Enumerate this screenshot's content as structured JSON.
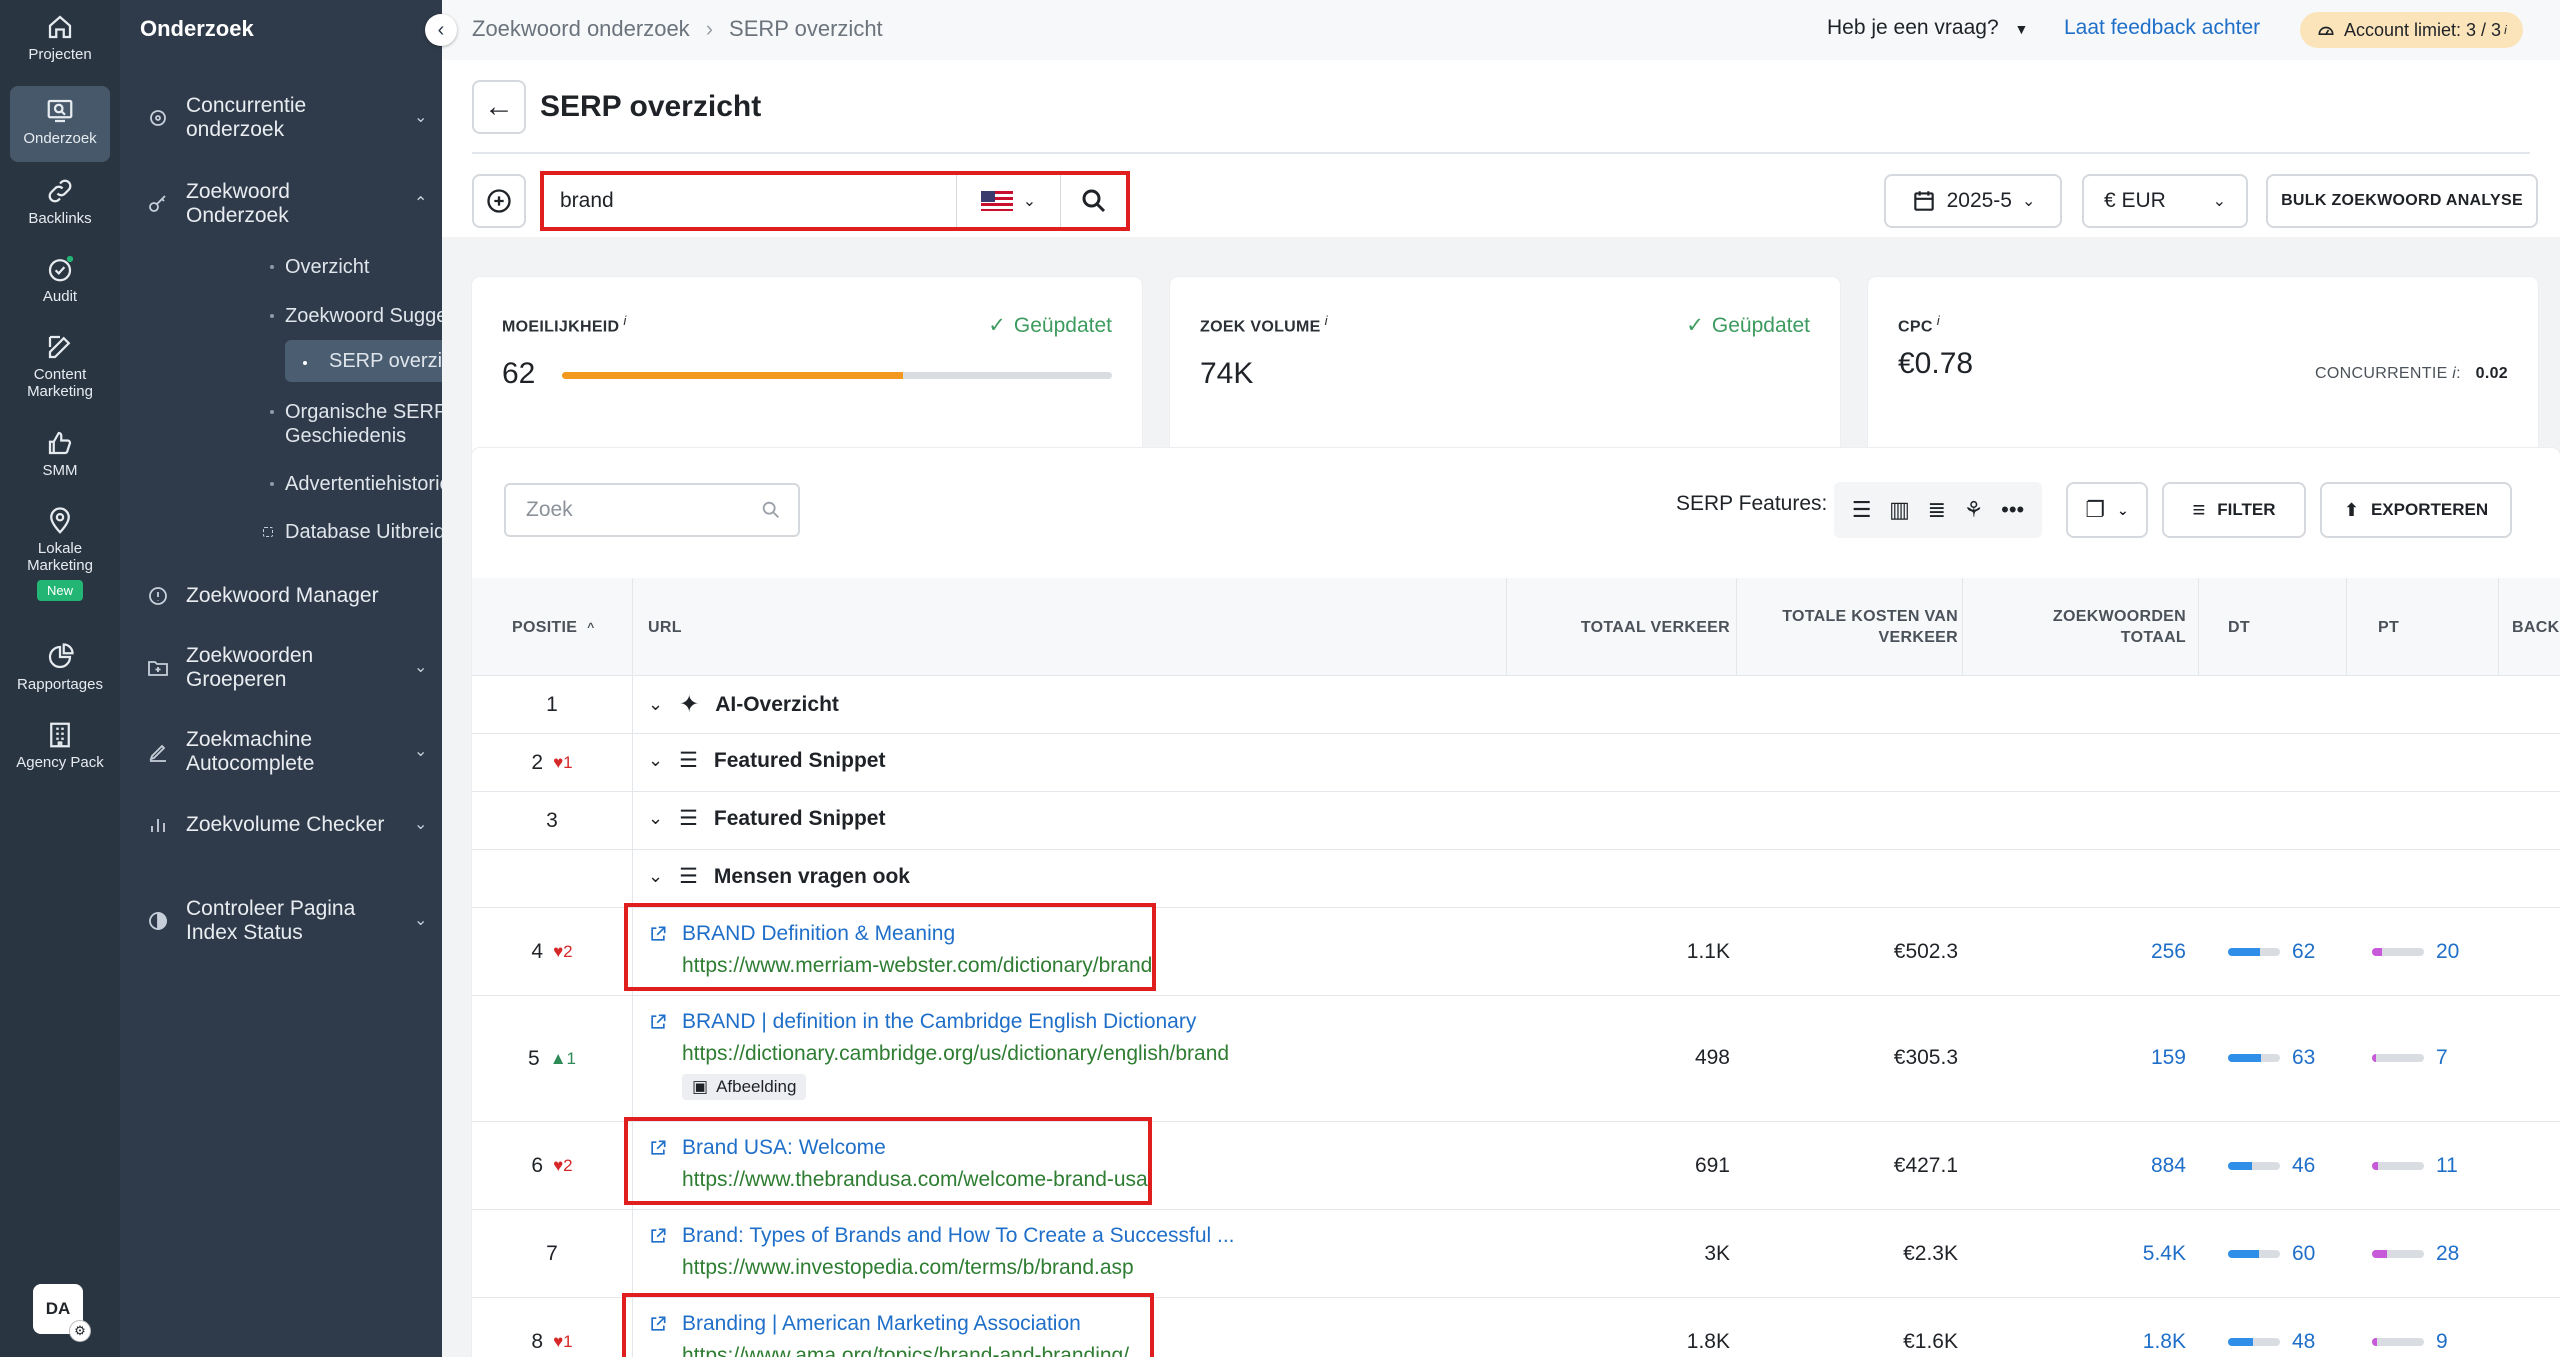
{
  "rail": [
    {
      "label": "Projecten",
      "icon": "home-icon"
    },
    {
      "label": "Onderzoek",
      "icon": "research-icon",
      "active": true
    },
    {
      "label": "Backlinks",
      "icon": "link-icon"
    },
    {
      "label": "Audit",
      "icon": "audit-icon"
    },
    {
      "label": "Content Marketing",
      "icon": "edit-icon"
    },
    {
      "label": "SMM",
      "icon": "thumbs-up-icon"
    },
    {
      "label": "Lokale Marketing",
      "icon": "location-pin-icon",
      "badge": "New"
    },
    {
      "label": "Rapportages",
      "icon": "pie-chart-icon"
    },
    {
      "label": "Agency Pack",
      "icon": "building-icon"
    }
  ],
  "avatar": "DA",
  "sidebar": {
    "title": "Onderzoek",
    "items": [
      {
        "label": "Concurrentie onderzoek"
      },
      {
        "label": "Zoekwoord Onderzoek"
      },
      {
        "label": "Zoekwoord Manager"
      },
      {
        "label": "Zoekwoorden Groeperen"
      },
      {
        "label": "Zoekmachine Autocomplete"
      },
      {
        "label": "Zoekvolume Checker"
      },
      {
        "label": "Controleer Pagina Index Status"
      }
    ],
    "children": [
      {
        "label": "Overzicht"
      },
      {
        "label": "Zoekwoord Suggesties"
      },
      {
        "label": "SERP overzicht",
        "active": true
      },
      {
        "label": "Organische SERP Geschiedenis"
      },
      {
        "label": "Advertentiehistorie"
      },
      {
        "label": "Database Uitbreiding"
      }
    ]
  },
  "header": {
    "crumb1": "Zoekwoord onderzoek",
    "crumb2": "SERP overzicht",
    "help": "Heb je een vraag?",
    "feedback": "Laat feedback achter",
    "limit": "Account limiet: 3 / 3"
  },
  "page": {
    "title": "SERP overzicht",
    "search_value": "brand",
    "country": "US",
    "date": "2025-5",
    "currency": "€ EUR",
    "bulk": "BULK ZOEKWOORD ANALYSE"
  },
  "cards": {
    "difficulty": {
      "label": "MOEILIJKHEID",
      "value": "62",
      "percent": 62,
      "status": "Geüpdatet"
    },
    "volume": {
      "label": "ZOEK VOLUME",
      "value": "74K",
      "status": "Geüpdatet"
    },
    "cpc": {
      "label": "CPC",
      "value": "€0.78",
      "competition_label": "CONCURRENTIE",
      "competition_value": "0.02"
    }
  },
  "toolbar": {
    "search_placeholder": "Zoek",
    "serp_features": "SERP Features:",
    "filter": "FILTER",
    "export": "EXPORTEREN"
  },
  "columns": {
    "position": "POSITIE",
    "url": "URL",
    "traffic": "TOTAAL VERKEER",
    "cost": "TOTALE KOSTEN VAN VERKEER",
    "keywords": "ZOEKWOORDEN TOTAAL",
    "dt": "DT",
    "pt": "PT",
    "backlinks": "BACKL"
  },
  "feature_rows": [
    {
      "pos": "1",
      "change": "",
      "label": "AI-Overzicht"
    },
    {
      "pos": "2",
      "change": "1",
      "dir": "down",
      "label": "Featured Snippet"
    },
    {
      "pos": "3",
      "change": "",
      "label": "Featured Snippet"
    },
    {
      "pos": "",
      "change": "",
      "label": "Mensen vragen ook"
    }
  ],
  "results": [
    {
      "pos": "4",
      "change": "2",
      "dir": "down",
      "title": "BRAND Definition & Meaning",
      "url": "https://www.merriam-webster.com/dictionary/brand",
      "traffic": "1.1K",
      "cost": "€502.3",
      "keywords": "256",
      "dt": "62",
      "pt": "20"
    },
    {
      "pos": "5",
      "change": "1",
      "dir": "up",
      "title": "BRAND | definition in the Cambridge English Dictionary",
      "url": "https://dictionary.cambridge.org/us/dictionary/english/brand",
      "badge": "Afbeelding",
      "traffic": "498",
      "cost": "€305.3",
      "keywords": "159",
      "dt": "63",
      "pt": "7"
    },
    {
      "pos": "6",
      "change": "2",
      "dir": "down",
      "title": "Brand USA: Welcome",
      "url": "https://www.thebrandusa.com/welcome-brand-usa",
      "traffic": "691",
      "cost": "€427.1",
      "keywords": "884",
      "dt": "46",
      "pt": "11"
    },
    {
      "pos": "7",
      "change": "",
      "title": "Brand: Types of Brands and How To Create a Successful ...",
      "url": "https://www.investopedia.com/terms/b/brand.asp",
      "traffic": "3K",
      "cost": "€2.3K",
      "keywords": "5.4K",
      "dt": "60",
      "pt": "28"
    },
    {
      "pos": "8",
      "change": "1",
      "dir": "down",
      "title": "Branding | American Marketing Association",
      "url": "https://www.ama.org/topics/brand-and-branding/",
      "traffic": "1.8K",
      "cost": "€1.6K",
      "keywords": "1.8K",
      "dt": "48",
      "pt": "9"
    }
  ],
  "colors": {
    "accent": "#1f6fc9",
    "highlight": "#e01e1e",
    "dt_bar": "#2f8fe8",
    "pt_bar": "#c75ad8",
    "difficulty_bar": "#f39a1e"
  }
}
